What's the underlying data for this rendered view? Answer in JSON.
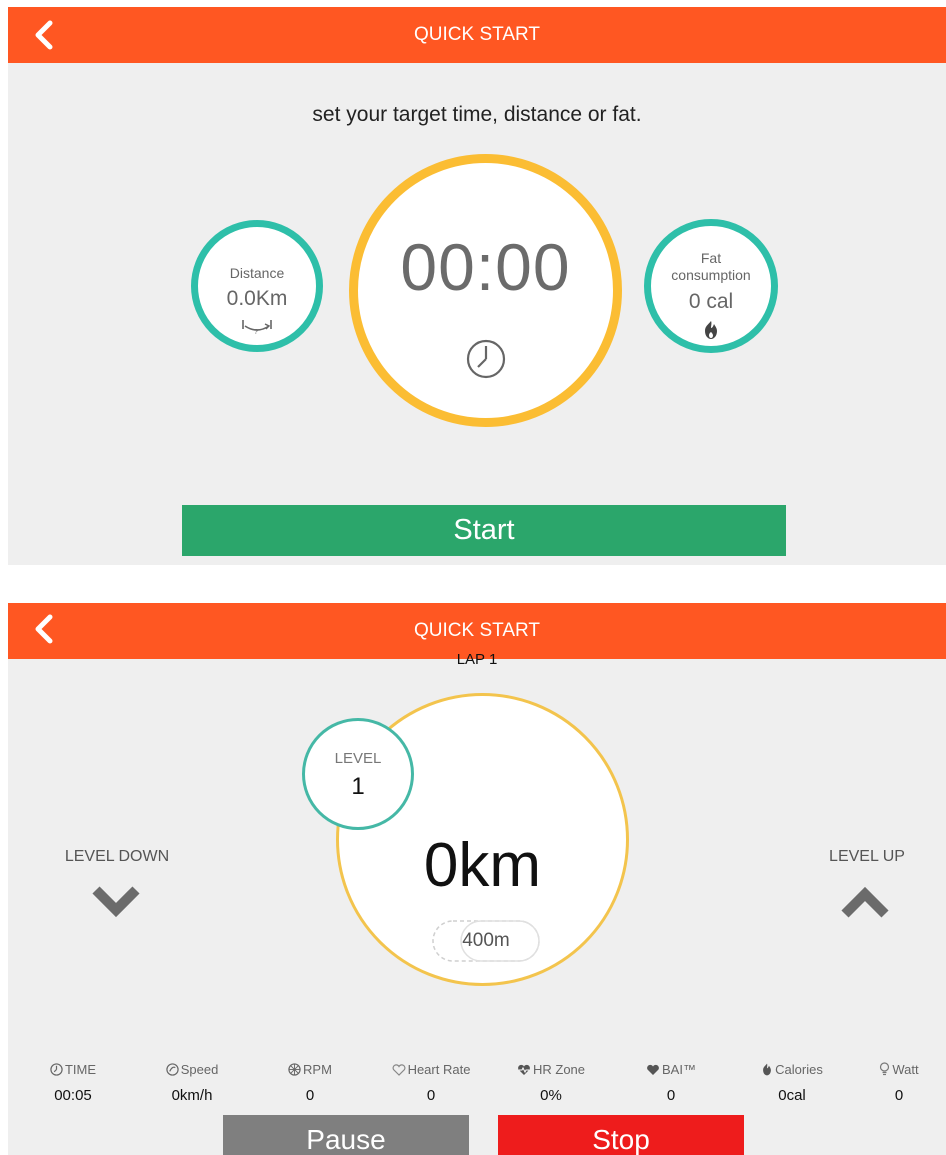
{
  "screen1": {
    "header": {
      "title": "QUICK START",
      "back_icon": "chevron-left-icon"
    },
    "prompt": "set your target time, distance or fat.",
    "distance": {
      "label": "Distance",
      "value": "0.0Km",
      "icon": "distance-icon"
    },
    "timer": {
      "value": "00:00",
      "icon": "clock-icon"
    },
    "fat": {
      "label_line1": "Fat",
      "label_line2": "consumption",
      "value": "0 cal",
      "icon": "flame-icon"
    },
    "start_label": "Start"
  },
  "screen2": {
    "header": {
      "title": "QUICK START",
      "back_icon": "chevron-left-icon"
    },
    "lap": "LAP 1",
    "level": {
      "label": "LEVEL",
      "value": "1"
    },
    "level_down_label": "LEVEL DOWN",
    "level_up_label": "LEVEL UP",
    "distance_value": "0km",
    "lap_length": "400m",
    "stats": [
      {
        "label": "TIME",
        "value": "00:05",
        "icon": "clock-icon"
      },
      {
        "label": "Speed",
        "value": "0km/h",
        "icon": "speed-icon"
      },
      {
        "label": "RPM",
        "value": "0",
        "icon": "rpm-icon"
      },
      {
        "label": "Heart Rate",
        "value": "0",
        "icon": "heart-icon"
      },
      {
        "label": "HR Zone",
        "value": "0%",
        "icon": "hr-zone-icon"
      },
      {
        "label": "BAI™",
        "value": "0",
        "icon": "bai-icon"
      },
      {
        "label": "Calories",
        "value": "0cal",
        "icon": "flame-icon"
      },
      {
        "label": "Watt",
        "value": "0",
        "icon": "bulb-icon"
      }
    ],
    "pause_label": "Pause",
    "stop_label": "Stop"
  },
  "colors": {
    "header": "#ff5722",
    "teal": "#2ebfa9",
    "gold": "#fbbd33",
    "start": "#2ba66b",
    "pause": "#7f7f7f",
    "stop": "#ee1c1c",
    "background": "#efefef"
  }
}
